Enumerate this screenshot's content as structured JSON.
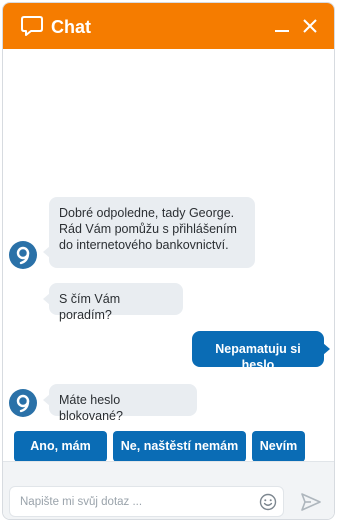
{
  "header": {
    "title": "Chat",
    "accent_color": "#f57c00",
    "icons": [
      "chat-bubble-icon",
      "minimize-icon",
      "close-icon"
    ]
  },
  "messages": [
    {
      "from": "bot",
      "text": "Dobré odpoledne, tady George.",
      "line2": "Rád Vám pomůžu s přihlášením",
      "line3": "do internetového bankovnictví."
    },
    {
      "from": "bot",
      "text": "S čím Vám poradím?"
    },
    {
      "from": "user",
      "text": "Nepamatuju si heslo"
    },
    {
      "from": "bot",
      "text": "Máte heslo blokované?"
    }
  ],
  "quick_replies": [
    "Ano, mám",
    "Ne, naštěstí nemám",
    "Nevím"
  ],
  "composer": {
    "placeholder": "Napište mi svůj dotaz ...",
    "value": "",
    "icons": [
      "emoji-icon",
      "send-icon"
    ]
  },
  "colors": {
    "user_bubble": "#0a6cb5",
    "bot_bubble": "#e9edf1",
    "avatar": "#2a71a8"
  }
}
